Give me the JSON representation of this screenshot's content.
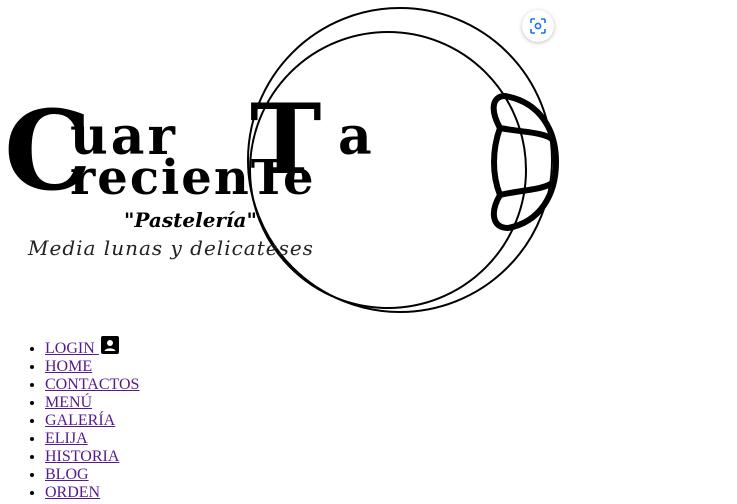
{
  "logo": {
    "letter_c": "C",
    "line1": "uar",
    "letter_t": "T",
    "line1_end": "a",
    "line2": "recienTe",
    "subtitle": "\"Pastelería\"",
    "tagline": "Media lunas y delicateses"
  },
  "icons": {
    "scan": "scan-icon",
    "login": "account-box-icon",
    "croissant": "croissant-icon"
  },
  "nav": {
    "items": [
      {
        "label": "LOGIN"
      },
      {
        "label": "HOME"
      },
      {
        "label": "CONTACTOS"
      },
      {
        "label": "MENÚ"
      },
      {
        "label": "GALERÍA"
      },
      {
        "label": "ELIJA"
      },
      {
        "label": "HISTORIA"
      },
      {
        "label": "BLOG"
      },
      {
        "label": "ORDEN"
      }
    ]
  },
  "colors": {
    "link": "#551a8b",
    "text": "#000000",
    "background": "#ffffff"
  }
}
